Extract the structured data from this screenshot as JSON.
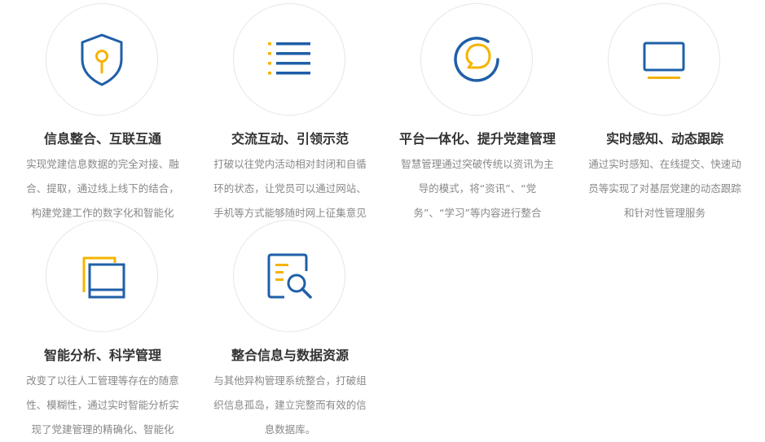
{
  "colors": {
    "blue": "#1f5fa8",
    "yellow": "#f4b400",
    "title": "#333333",
    "text": "#888888"
  },
  "features": [
    {
      "icon": "shield-key-icon",
      "title": "信息整合、互联互通",
      "lines": [
        "实现党建信息数据的完全对接、融",
        "合、提取，通过线上线下的结合，",
        "构建党建工作的数字化和智能化"
      ]
    },
    {
      "icon": "list-icon",
      "title": "交流互动、引领示范",
      "lines": [
        "打破以往党内活动相对封闭和自循",
        "环的状态，让党员可以通过网站、",
        "手机等方式能够随时网上征集意见"
      ]
    },
    {
      "icon": "chat-bubble-icon",
      "title": "平台一体化、提升党建管理",
      "lines": [
        "智慧管理通过突破传统以资讯为主",
        "导的模式，将“资讯”、“党",
        "务”、“学习”等内容进行整合"
      ]
    },
    {
      "icon": "monitor-icon",
      "title": "实时感知、动态跟踪",
      "lines": [
        "通过实时感知、在线提交、快速动",
        "员等实现了对基层党建的动态跟踪",
        "和针对性管理服务"
      ]
    },
    {
      "icon": "stacked-windows-icon",
      "title": "智能分析、科学管理",
      "lines": [
        "改变了以往人工管理等存在的随意",
        "性、模糊性，通过实时智能分析实",
        "现了党建管理的精确化、智能化"
      ]
    },
    {
      "icon": "document-search-icon",
      "title": "整合信息与数据资源",
      "lines": [
        "与其他异构管理系统整合，打破组",
        "织信息孤岛，建立完整而有效的信",
        "息数据库。"
      ]
    }
  ]
}
